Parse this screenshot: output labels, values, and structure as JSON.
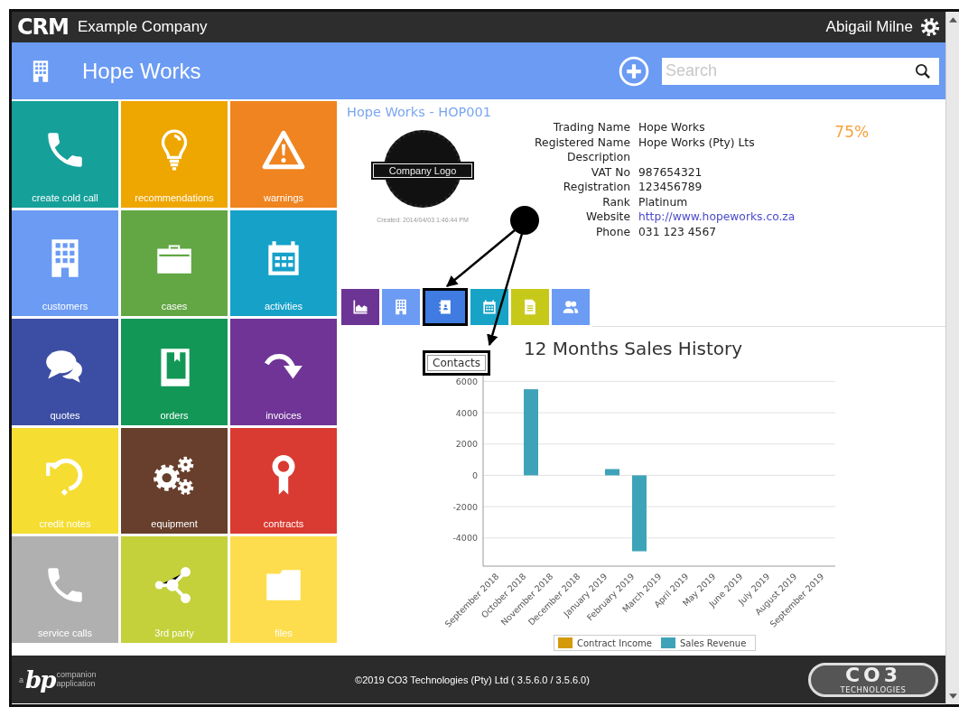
{
  "header": {
    "logo": "CRM",
    "company": "Example Company",
    "user": "Abigail Milne"
  },
  "title_bar": {
    "title": "Hope Works",
    "search": {
      "placeholder": "Search"
    }
  },
  "tiles": [
    {
      "label": "create cold call",
      "color": "#16a09a"
    },
    {
      "label": "recommendations",
      "color": "#eea600"
    },
    {
      "label": "warnings",
      "color": "#ef8420"
    },
    {
      "label": "customers",
      "color": "#6b9bf3"
    },
    {
      "label": "cases",
      "color": "#62a744"
    },
    {
      "label": "activities",
      "color": "#16a1c9"
    },
    {
      "label": "quotes",
      "color": "#3c4ea3"
    },
    {
      "label": "orders",
      "color": "#139757"
    },
    {
      "label": "invoices",
      "color": "#6f3496"
    },
    {
      "label": "credit notes",
      "color": "#f5dd32"
    },
    {
      "label": "equipment",
      "color": "#673f2c"
    },
    {
      "label": "contracts",
      "color": "#d93a31"
    },
    {
      "label": "service calls",
      "color": "#b0b0b0"
    },
    {
      "label": "3rd party",
      "color": "#c4d13a"
    },
    {
      "label": "files",
      "color": "#fddd4e"
    }
  ],
  "record": {
    "heading": "Hope Works - HOP001",
    "logo_text": "Company Logo",
    "created": "Created: 2014/04/03 1:46:44 PM",
    "fields": [
      {
        "label": "Trading Name",
        "value": "Hope Works",
        "kind": "text"
      },
      {
        "label": "Registered Name",
        "value": "Hope Works (Pty) Lts",
        "kind": "text"
      },
      {
        "label": "Description"
      },
      {
        "label": "VAT No",
        "value": "987654321",
        "kind": "text"
      },
      {
        "label": "Registration",
        "value": "123456789",
        "kind": "text"
      },
      {
        "label": "Rank",
        "value": "Platinum",
        "kind": "text"
      },
      {
        "label": "Website",
        "value": "http://www.hopeworks.co.za",
        "kind": "link"
      },
      {
        "label": "Phone",
        "value": "031 123 4567",
        "kind": "text"
      }
    ],
    "score": "75%",
    "tabs": [
      {
        "color": "#6c3494",
        "selected": false
      },
      {
        "color": "#6b9bf3",
        "selected": false
      },
      {
        "color": "#3f7be0",
        "selected": true
      },
      {
        "color": "#17a3c6",
        "selected": false
      },
      {
        "color": "#c7c91a",
        "selected": false
      },
      {
        "color": "#6b9bf3",
        "selected": false
      }
    ],
    "tooltip": "Contacts",
    "chart": {
      "chart_data": {
        "type": "bar",
        "title": "12 Months Sales History",
        "categories": [
          "September 2018",
          "October 2018",
          "November 2018",
          "December 2018",
          "January 2019",
          "February 2019",
          "March 2019",
          "April 2019",
          "May 2019",
          "June 2019",
          "July 2019",
          "August 2019",
          "September 2019"
        ],
        "series": [
          {
            "name": "Contract Income",
            "color": "#d49a0a",
            "values": [
              null,
              null,
              null,
              null,
              null,
              null,
              null,
              null,
              null,
              null,
              null,
              null,
              null
            ]
          },
          {
            "name": "Sales Revenue",
            "color": "#3ea3b8",
            "values": [
              null,
              5500,
              null,
              null,
              400,
              -4850,
              null,
              null,
              null,
              null,
              null,
              null,
              null
            ]
          }
        ],
        "grid": true,
        "ylim": [
          -5800,
          6600
        ],
        "yticks": [
          -4000,
          -2000,
          0,
          2000,
          4000,
          6000
        ]
      }
    }
  },
  "footer": {
    "left_logo": {
      "prefix": "a",
      "mark": "bp",
      "line_1": "companion",
      "line_2": "application"
    },
    "copyright": "©2019 CO3 Technologies (Pty) Ltd ( 3.5.6.0 / 3.5.6.0)",
    "right_logo": {
      "mark": "CO3",
      "tagline": "TECHNOLOGIES"
    }
  }
}
